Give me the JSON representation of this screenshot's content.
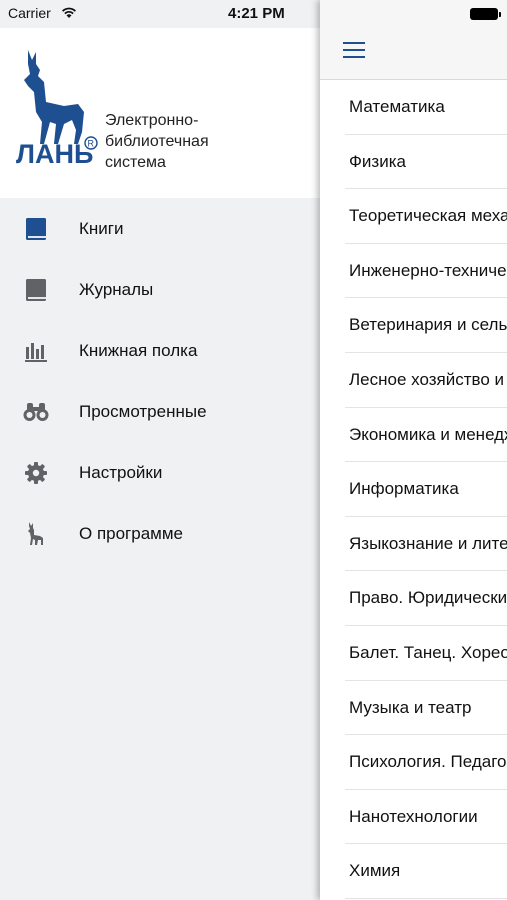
{
  "status_bar": {
    "carrier": "Carrier",
    "time": "4:21 PM"
  },
  "drawer": {
    "brand_lines": [
      "Электронно-",
      "библиотечная",
      "система"
    ],
    "logo_text": "ЛАНЬ",
    "logo_color": "#1d4f91",
    "menu_items": [
      {
        "label": "Книги",
        "icon": "book-icon"
      },
      {
        "label": "Журналы",
        "icon": "journal-icon"
      },
      {
        "label": "Книжная полка",
        "icon": "bookshelf-icon"
      },
      {
        "label": "Просмотренные",
        "icon": "binoculars-icon"
      },
      {
        "label": "Настройки",
        "icon": "gear-icon"
      },
      {
        "label": "О программе",
        "icon": "deer-icon"
      }
    ]
  },
  "main": {
    "categories": [
      "Математика",
      "Физика",
      "Теоретическая механика",
      "Инженерно-технические науки",
      "Ветеринария и сельское хозяйство",
      "Лесное хозяйство и лесоинженерное дело",
      "Экономика и менеджмент",
      "Информатика",
      "Языкознание и литературоведение",
      "Право. Юридические науки",
      "Балет. Танец. Хореография",
      "Музыка и театр",
      "Психология. Педагогика",
      "Нанотехнологии",
      "Химия"
    ]
  }
}
